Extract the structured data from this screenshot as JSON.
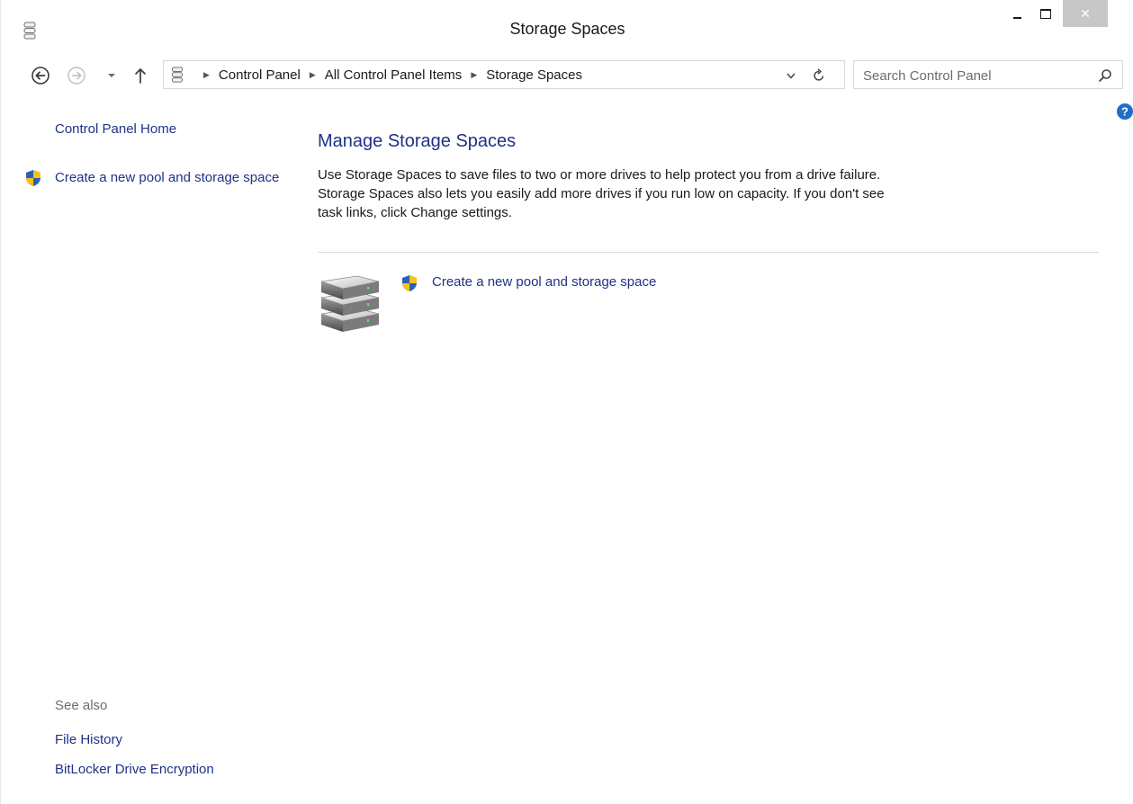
{
  "window": {
    "title": "Storage Spaces",
    "close_glyph": "✕",
    "app_icon": "storage-spaces-icon"
  },
  "navigation": {
    "back_icon": "back-arrow-icon",
    "forward_icon": "forward-arrow-icon",
    "recent_icon": "chevron-down-icon",
    "up_icon": "up-arrow-icon",
    "breadcrumbs": [
      "Control Panel",
      "All Control Panel Items",
      "Storage Spaces"
    ],
    "search_placeholder": "Search Control Panel"
  },
  "sidebar": {
    "home_link": "Control Panel Home",
    "task_link": "Create a new pool and storage space",
    "see_also_heading": "See also",
    "see_also_links": [
      "File History",
      "BitLocker Drive Encryption"
    ]
  },
  "main": {
    "title": "Manage Storage Spaces",
    "description": "Use Storage Spaces to save files to two or more drives to help protect you from a drive failure. Storage Spaces also lets you easily add more drives if you run low on capacity. If you don't see task links, click Change settings.",
    "task_link": "Create a new pool and storage space"
  },
  "colors": {
    "link": "#1e3287",
    "text": "#1a1a1a",
    "muted": "#6d6d6d",
    "close_button": "#c7c7c7",
    "help": "#1f6fc7"
  }
}
